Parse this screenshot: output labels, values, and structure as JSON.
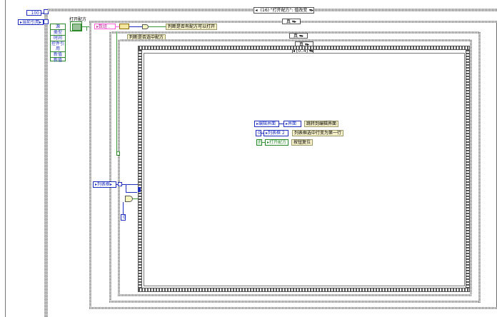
{
  "numeric_constant": "100",
  "queue_ref": "▸当前引用▸",
  "enum_items": [
    "源",
    "类型",
    "时间",
    "控件引用",
    "新值",
    "新值"
  ],
  "open_recipe_caption": "打开配方",
  "top_case_selector": "(16) \"打开配方\": 值改变",
  "bool_case_true": "真",
  "array_label": "▸数组 .",
  "open_check_label": "判断是否有配方可以打开",
  "select_check_label": "判断是否选中配方",
  "case_true_2": "真",
  "case_true_3": "真",
  "range_selector": "[0..4]",
  "list_box_label": "▸列表框▸",
  "zero_const_left": "0",
  "row1": {
    "src": "▸编辑界面",
    "dst": "▸界面",
    "note": "跳转到编辑界面"
  },
  "row2": {
    "src": "0",
    "dst": "▸列表框 2",
    "note": "列表框选中行变为第一行"
  },
  "row3": {
    "src": "F",
    "dst": "▸打开配方",
    "note": "按钮复位"
  }
}
